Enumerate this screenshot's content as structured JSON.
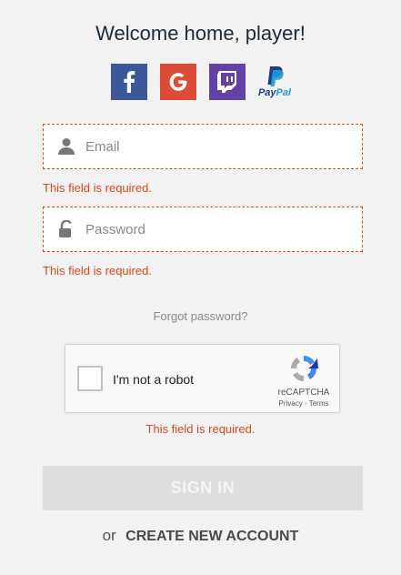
{
  "header": {
    "title": "Welcome home, player!"
  },
  "social": [
    {
      "icon": "facebook-icon",
      "color": "#3b5998"
    },
    {
      "icon": "google-icon",
      "color": "#dd4b39"
    },
    {
      "icon": "twitch-icon",
      "color": "#6441a5"
    },
    {
      "icon": "paypal-icon",
      "label_a": "Pay",
      "label_b": "Pal"
    }
  ],
  "form": {
    "email": {
      "placeholder": "Email",
      "value": "",
      "icon": "user-icon"
    },
    "email_error": "This field is required.",
    "password": {
      "placeholder": "Password",
      "value": "",
      "icon": "lock-icon"
    },
    "password_error": "This field is required.",
    "forgot": "Forgot password?"
  },
  "captcha": {
    "label": "I'm not a robot",
    "brand": "reCAPTCHA",
    "links": "Privacy - Terms",
    "error": "This field is required."
  },
  "actions": {
    "sign_in": "SIGN IN",
    "or": "or",
    "create": "CREATE NEW ACCOUNT"
  },
  "colors": {
    "error": "#e0471b",
    "background": "#f2f2f2",
    "button_disabled": "#dedede"
  }
}
